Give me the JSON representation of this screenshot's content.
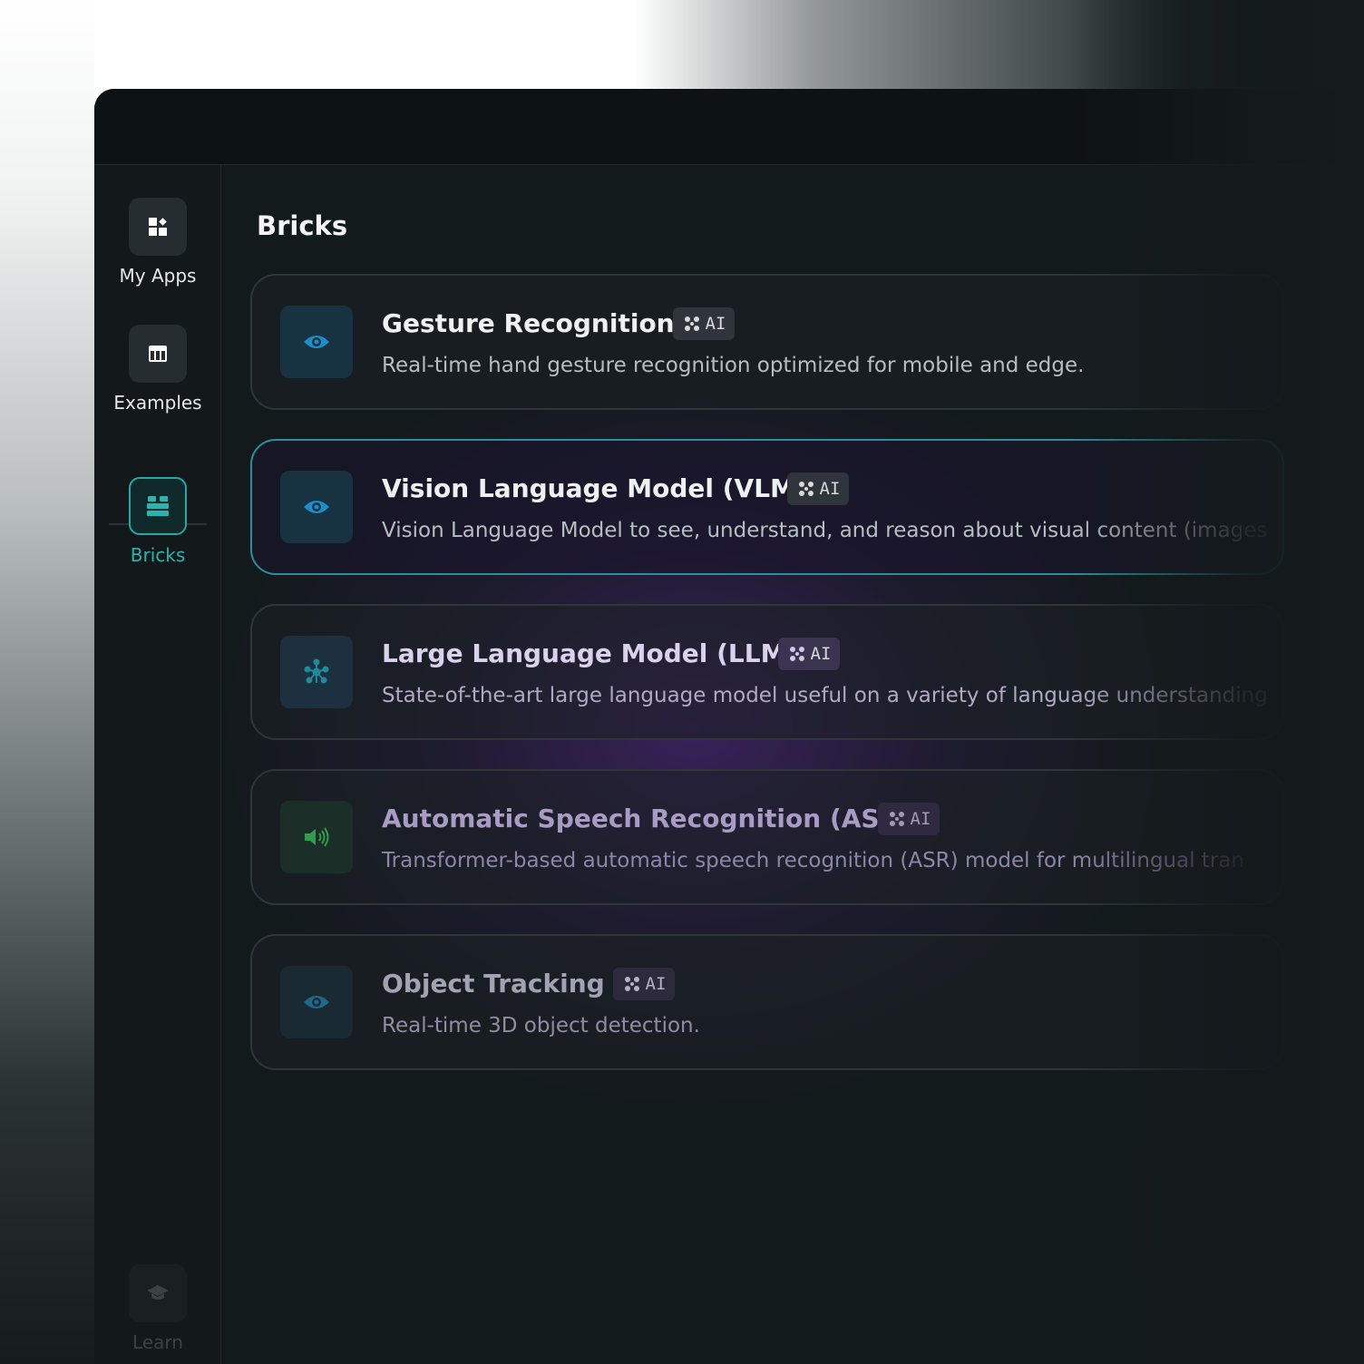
{
  "sidebar": {
    "items": [
      {
        "label": "My Apps",
        "icon": "apps-grid-icon"
      },
      {
        "label": "Examples",
        "icon": "table-layout-icon"
      },
      {
        "label": "Bricks",
        "icon": "bricks-icon",
        "active": true
      },
      {
        "label": "Learn",
        "icon": "graduation-cap-icon"
      }
    ]
  },
  "main": {
    "title": "Bricks",
    "bricks": [
      {
        "title": "Gesture Recognition",
        "badge": "AI",
        "icon": "eye-icon",
        "description": "Real-time hand gesture recognition optimized for mobile and edge."
      },
      {
        "title": "Vision Language Model (VLM)",
        "badge": "AI",
        "icon": "eye-icon",
        "description": "Vision Language Model to see, understand, and reason about visual content (images",
        "selected": true
      },
      {
        "title": "Large Language Model (LLM)",
        "badge": "AI",
        "icon": "network-nodes-icon",
        "description": "State-of-the-art large language model useful on a variety of language understanding"
      },
      {
        "title": "Automatic Speech Recognition (ASR)",
        "badge": "AI",
        "icon": "speaker-sound-icon",
        "description": "Transformer-based automatic speech recognition (ASR) model for multilingual tran"
      },
      {
        "title": "Object Tracking",
        "badge": "AI",
        "icon": "eye-icon",
        "description": "Real-time 3D object detection."
      }
    ]
  },
  "colors": {
    "accent": "#2bb3b0",
    "icon_blue": "#1a8fc9",
    "icon_green": "#2f9e4e",
    "card_border": "#2e3639",
    "selected_border": "#2a8f9a"
  }
}
